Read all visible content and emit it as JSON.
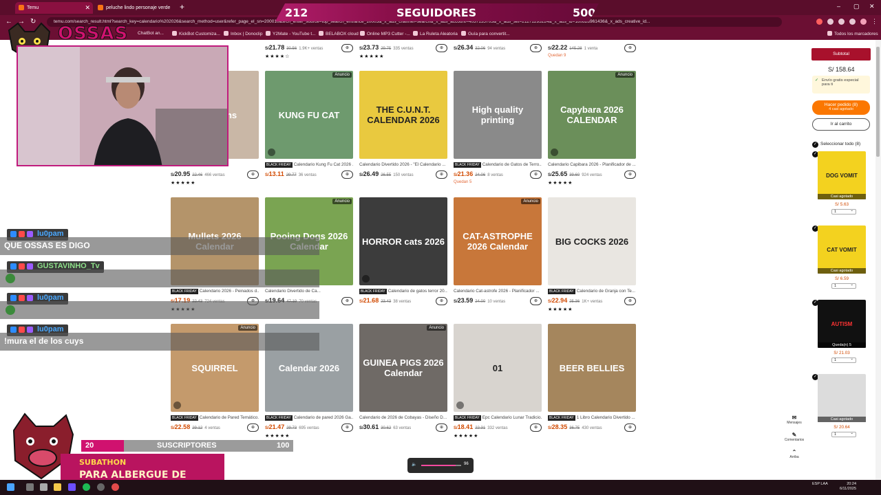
{
  "browser": {
    "tabs": [
      {
        "label": "Temu",
        "active": true
      },
      {
        "label": "peluche lindo personaje verde",
        "active": false
      }
    ],
    "url": "temu.com/search_result.html?search_key=calendario%202026&search_method=user&refer_page_el_sn=200010&srch_enter_source=top_search_entrance_10005&_x_ads_channel=search&_x_ads_account=4037135703&_x_ads_set=21171293224&_x_ads_id=160828961436&_x_ads_creative_id...",
    "bookmarks": [
      "ChatBot an...",
      "KickBot Customiza...",
      "Inbox | Donoclip",
      "Y2Mate - YouTube t...",
      "BELABOX cloud",
      "Online MP3 Cutter -...",
      "La Ruleta Aleatoria",
      "Guía para convertit..."
    ],
    "all_bookmarks": "Todos los marcadores"
  },
  "overlay": {
    "followers": {
      "current": "212",
      "label": "SEGUIDORES",
      "goal": "500"
    },
    "channel": "OSSAS",
    "subs": {
      "current": "20",
      "label": "SUSCRIPTORES",
      "goal": "100",
      "progress": 0.2
    },
    "subathon": {
      "title": "SUBATHON",
      "subtitle": "PARA ALBERGUE DE PERROS"
    },
    "volume": "96",
    "chat": [
      {
        "user": "lu0pam",
        "message": "QUE OSSAS ES DIGO",
        "color": "blue"
      },
      {
        "user": "GUSTAVINHO_Tv",
        "message": "",
        "color": "green"
      },
      {
        "user": "lu0pam",
        "message": "",
        "color": "blue"
      },
      {
        "user": "lu0pam",
        "message": "!mura el de los cuys",
        "color": "blue"
      }
    ]
  },
  "top_row": [
    {
      "price": "21.78",
      "was": "30.56",
      "sold": "1.9K+ ventas",
      "stars": "★★★★☆"
    },
    {
      "price": "23.73",
      "was": "29.75",
      "sold": "335 ventas",
      "stars": "★★★★★"
    },
    {
      "price": "26.34",
      "was": "32.06",
      "sold": "94 ventas",
      "stars": ""
    },
    {
      "price": "22.22",
      "was": "145.28",
      "sold": "1 venta",
      "stars": "",
      "low": "Quedan 9"
    }
  ],
  "products": [
    {
      "title": "Calendario 2026 Ga...",
      "price": "20.95",
      "was": "22.46",
      "sold": "466 ventas",
      "stars": "★★★★★",
      "bf": false,
      "ad": false,
      "color": "#c9b7a6",
      "label": "12 Months"
    },
    {
      "title": "Calendario Kung Fu Cat 2026 ...",
      "price": "13.11",
      "was": "29.77",
      "sold": "36 ventas",
      "stars": "",
      "bf": true,
      "ad": true,
      "color": "#6e9a6e",
      "label": "KUNG FU CAT"
    },
    {
      "title": "Calendario Divertido 2026 - \"El Calendario ...",
      "price": "26.49",
      "was": "26.55",
      "sold": "150 ventas",
      "stars": "",
      "bf": false,
      "ad": false,
      "color": "#e9c93f",
      "label": "THE C.U.N.T. CALENDAR 2026"
    },
    {
      "title": "Calendario de Gatos de Terro...",
      "price": "21.36",
      "was": "24.06",
      "sold": "8 ventas",
      "stars": "",
      "bf": true,
      "ad": false,
      "color": "#8a8a8a",
      "label": "High quality printing",
      "low": "Quedan 5"
    },
    {
      "title": "Calendario Capibara 2026 - Planificador de ...",
      "price": "25.65",
      "was": "39.60",
      "sold": "924 ventas",
      "stars": "★★★★★",
      "bf": false,
      "ad": true,
      "color": "#6b8f5a",
      "label": "Capybara 2026 CALENDAR"
    },
    {
      "title": "Calendario 2026 - Peinados d...",
      "price": "17.19",
      "was": "22.43",
      "sold": "724 ventas",
      "stars": "★★★★★",
      "bf": true,
      "ad": false,
      "color": "#b4946a",
      "label": "Mullets 2026 Calendar"
    },
    {
      "title": "Calendario Divertido de Ca...",
      "price": "19.64",
      "was": "47.19",
      "sold": "70 ventas",
      "stars": "",
      "bf": false,
      "ad": true,
      "color": "#7aa452",
      "label": "Pooing Dogs 2026 Calendar"
    },
    {
      "title": "Calendario de gatos terror 20...",
      "price": "21.68",
      "was": "23.43",
      "sold": "38 ventas",
      "stars": "",
      "bf": true,
      "ad": false,
      "color": "#3c3c3c",
      "label": "HORROR cats 2026"
    },
    {
      "title": "Calendario Cat-astrofe 2026 - Planificador ...",
      "price": "23.59",
      "was": "24.00",
      "sold": "10 ventas",
      "stars": "",
      "bf": false,
      "ad": true,
      "color": "#c8773a",
      "label": "CAT-ASTROPHE 2026 Calendar"
    },
    {
      "title": "Calendario de Granja con Te...",
      "price": "22.94",
      "was": "25.36",
      "sold": "1K+ ventas",
      "stars": "★★★★★",
      "bf": true,
      "ad": false,
      "color": "#e9e6e1",
      "label": "BIG COCKS 2026"
    },
    {
      "title": "Calendario de Pared Temático...",
      "price": "22.58",
      "was": "29.12",
      "sold": "4 ventas",
      "stars": "",
      "bf": true,
      "ad": true,
      "color": "#c49a6c",
      "label": "SQUIRREL"
    },
    {
      "title": "Calendario de pared 2026 Ga...",
      "price": "21.47",
      "was": "29.73",
      "sold": "695 ventas",
      "stars": "★★★★★",
      "bf": true,
      "ad": false,
      "color": "#9aa0a3",
      "label": "Calendar 2026"
    },
    {
      "title": "Calendario de 2026 de Cobayas - Diseño D...",
      "price": "30.61",
      "was": "30.62",
      "sold": "63 ventas",
      "stars": "",
      "bf": false,
      "ad": true,
      "color": "#6f6a66",
      "label": "GUINEA PIGS 2026 Calendar"
    },
    {
      "title": "Epc Calendario Lunar Tradicio...",
      "price": "18.41",
      "was": "22.31",
      "sold": "332 ventas",
      "stars": "★★★★★",
      "bf": true,
      "ad": false,
      "color": "#d8d4cf",
      "label": "01"
    },
    {
      "title": "1 Libro Calendario Divertido ...",
      "price": "28.35",
      "was": "36.75",
      "sold": "430 ventas",
      "stars": "",
      "bf": true,
      "ad": false,
      "color": "#a5865d",
      "label": "BEER BELLIES"
    }
  ],
  "labels": {
    "ad": "Anuncio",
    "black_friday": "BLACK FRIDAY",
    "currency": "S/",
    "cart_icon": "⊕"
  },
  "sidebar": {
    "subtotal_button": "Subtotal",
    "subtotal_value": "S/ 158.64",
    "shipping": "Envío gratis especial para ti",
    "order_button": "Hacer pedido (8)",
    "order_sub": "4 casi agotado",
    "go_cart": "Ir al carrito",
    "select_all": "Seleccionar todo (8)",
    "items": [
      {
        "price": "S/ 5.63",
        "qty": "1",
        "tag": "Casi agotado",
        "label": "DOG VOMIT",
        "color": "#f3d21f"
      },
      {
        "price": "S/ 6.59",
        "qty": "1",
        "tag": "Casi agotado",
        "label": "CAT VOMIT",
        "color": "#f3d21f"
      },
      {
        "price": "S/ 21.03",
        "qty": "1",
        "tag": "Queda(n) 5",
        "label": "AUTISM",
        "color": "#111111"
      },
      {
        "price": "S/ 20.64",
        "qty": "1",
        "tag": "Casi agotado",
        "label": "",
        "color": "#dcdcdc"
      }
    ],
    "rail": [
      "Mensajes",
      "Comentarios",
      "Arriba"
    ]
  },
  "taskbar": {
    "lang": "ESP LAA",
    "time": "20:24",
    "date": "6/11/2025"
  },
  "colors": {
    "accent": "#fb7701",
    "brand": "#a8112c",
    "stream": "#d0126f"
  }
}
